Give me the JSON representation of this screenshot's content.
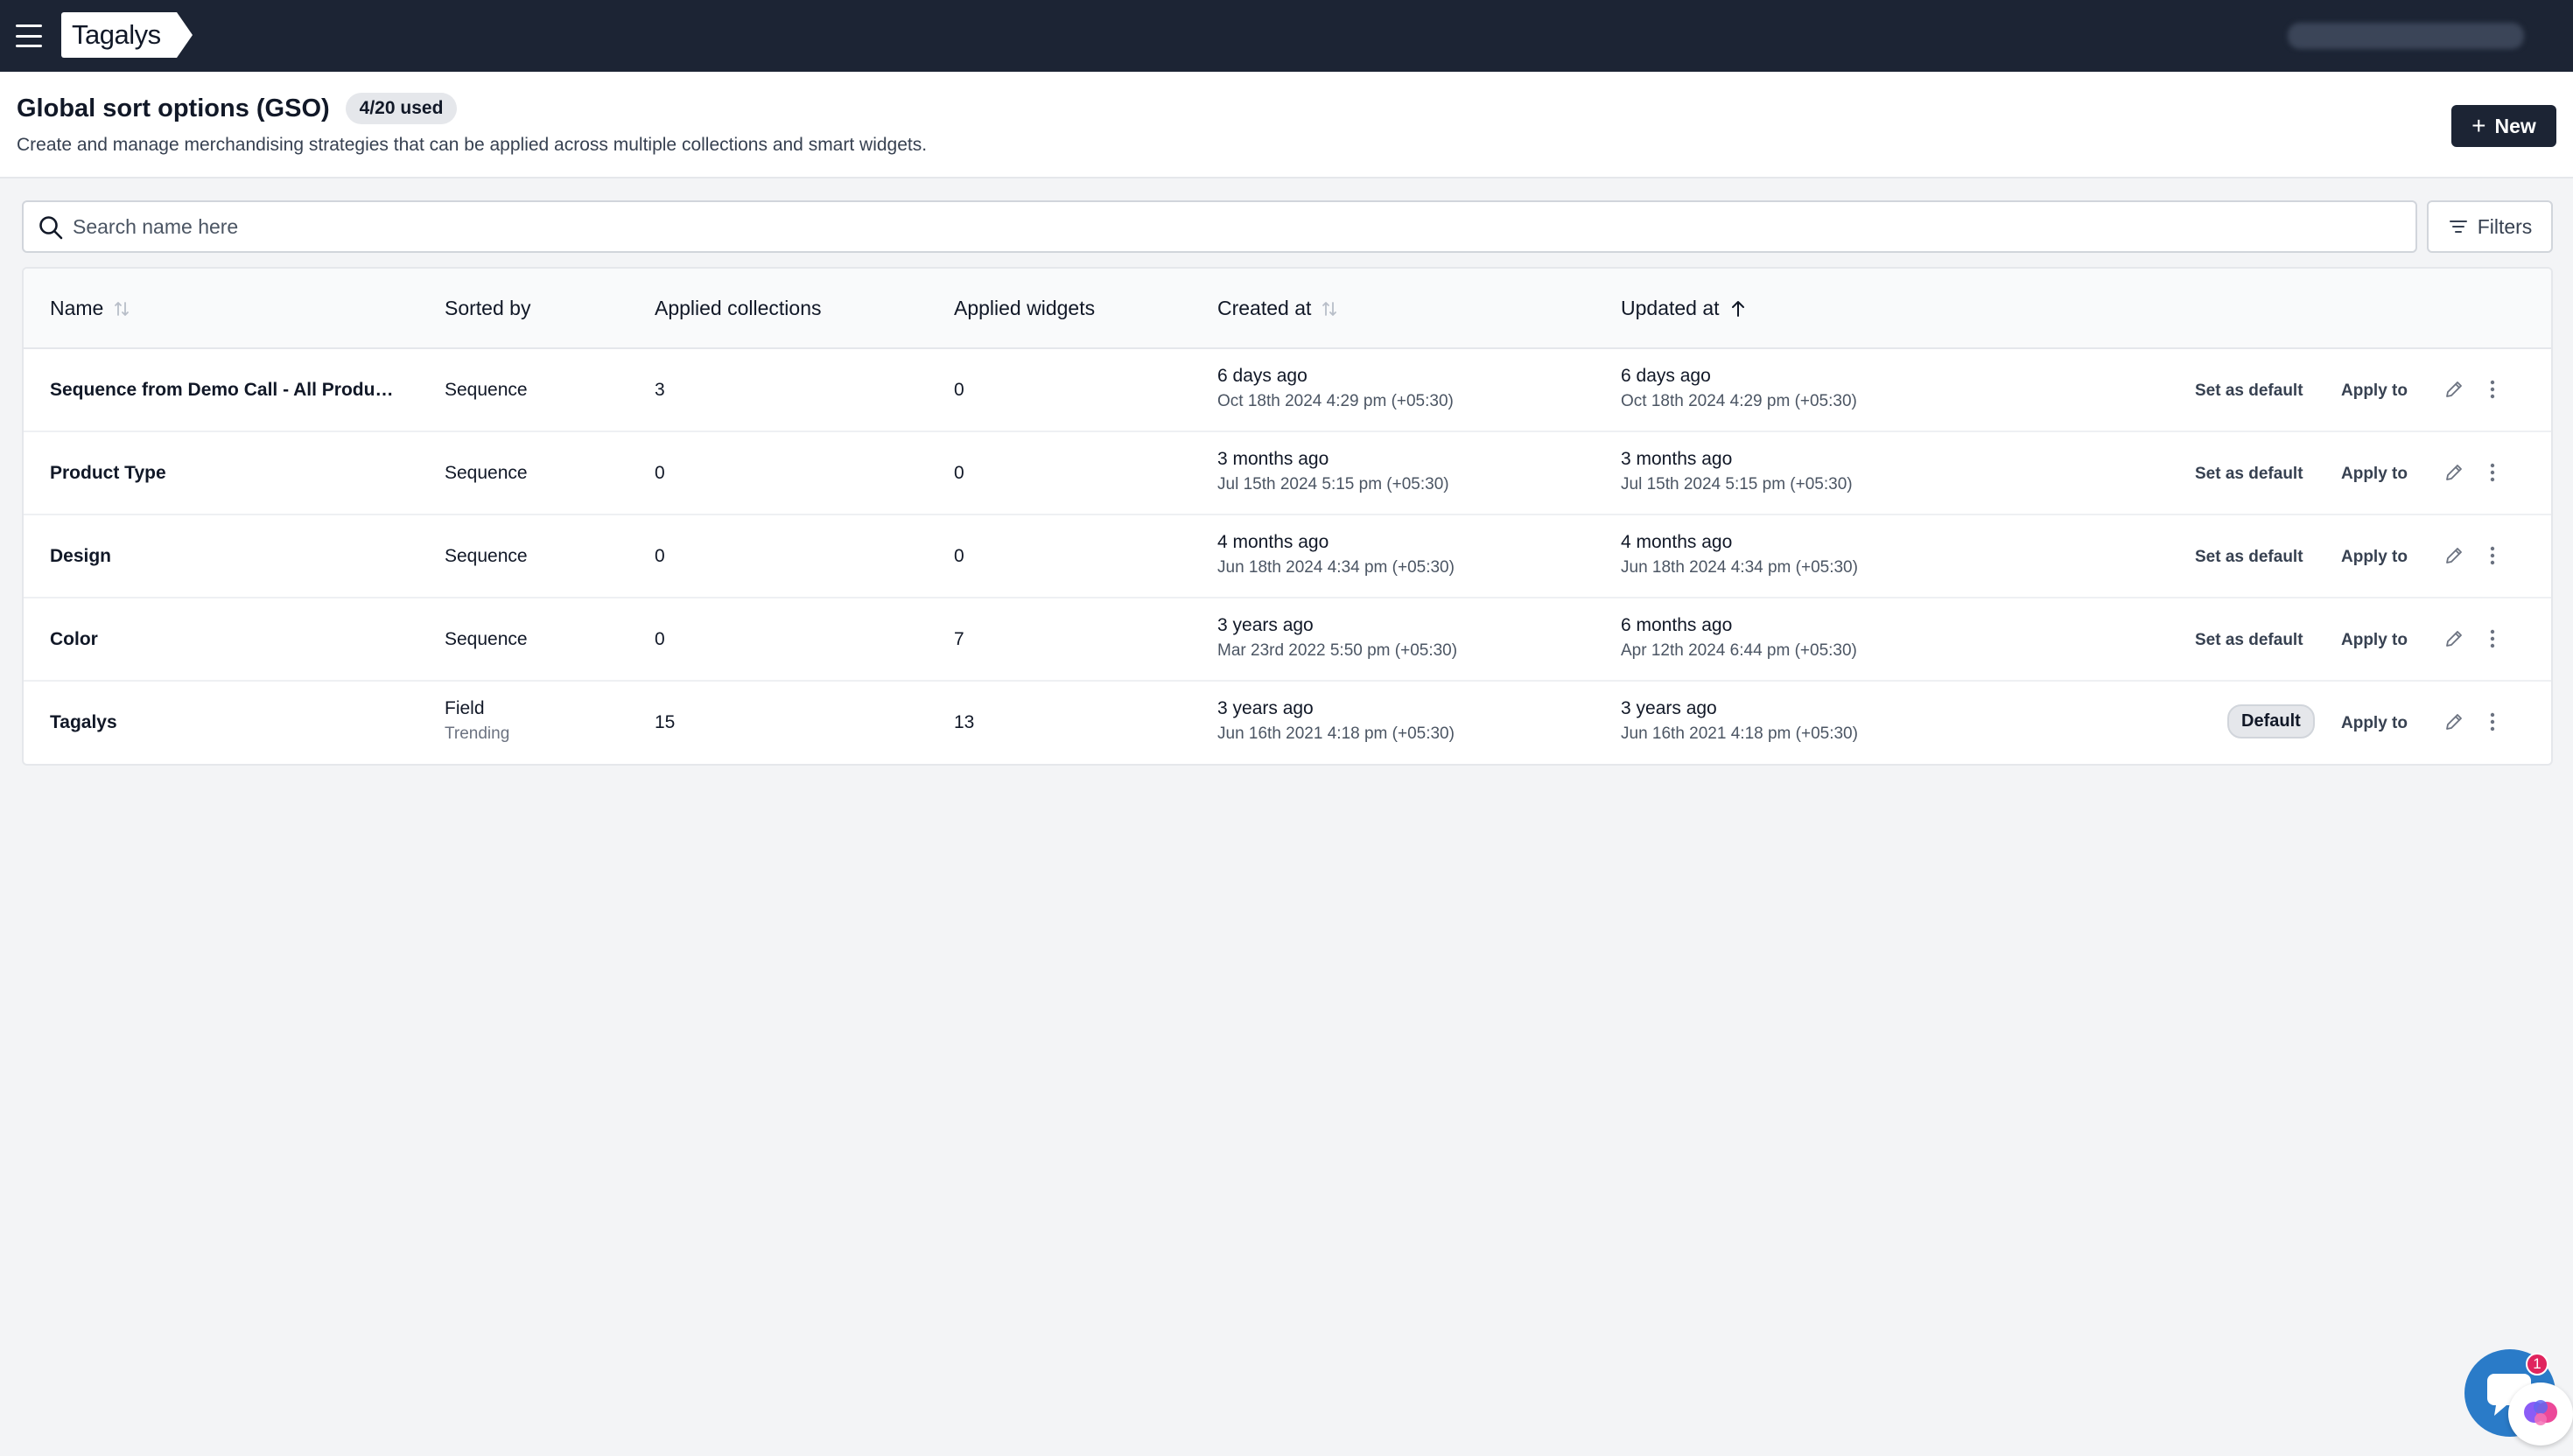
{
  "app": {
    "logo_text": "Tagalys"
  },
  "header": {
    "title": "Global sort options (GSO)",
    "used_badge": "4/20 used",
    "subtitle": "Create and manage merchandising strategies that can be applied across multiple collections and smart widgets.",
    "new_button": "New"
  },
  "search": {
    "placeholder": "Search name here",
    "value": ""
  },
  "filters_button": "Filters",
  "table": {
    "columns": {
      "name": "Name",
      "sorted_by": "Sorted by",
      "applied_collections": "Applied collections",
      "applied_widgets": "Applied widgets",
      "created_at": "Created at",
      "updated_at": "Updated at"
    },
    "rows": [
      {
        "name": "Sequence from Demo Call - All Produc...",
        "sorted_by": "Sequence",
        "sorted_by_sub": "",
        "collections": "3",
        "widgets": "0",
        "created_rel": "6 days ago",
        "created_abs": "Oct 18th 2024 4:29 pm (+05:30)",
        "updated_rel": "6 days ago",
        "updated_abs": "Oct 18th 2024 4:29 pm (+05:30)",
        "set_default": "Set as default",
        "apply_to": "Apply to"
      },
      {
        "name": "Product Type",
        "sorted_by": "Sequence",
        "sorted_by_sub": "",
        "collections": "0",
        "widgets": "0",
        "created_rel": "3 months ago",
        "created_abs": "Jul 15th 2024 5:15 pm (+05:30)",
        "updated_rel": "3 months ago",
        "updated_abs": "Jul 15th 2024 5:15 pm (+05:30)",
        "set_default": "Set as default",
        "apply_to": "Apply to"
      },
      {
        "name": "Design",
        "sorted_by": "Sequence",
        "sorted_by_sub": "",
        "collections": "0",
        "widgets": "0",
        "created_rel": "4 months ago",
        "created_abs": "Jun 18th 2024 4:34 pm (+05:30)",
        "updated_rel": "4 months ago",
        "updated_abs": "Jun 18th 2024 4:34 pm (+05:30)",
        "set_default": "Set as default",
        "apply_to": "Apply to"
      },
      {
        "name": "Color",
        "sorted_by": "Sequence",
        "sorted_by_sub": "",
        "collections": "0",
        "widgets": "7",
        "created_rel": "3 years ago",
        "created_abs": "Mar 23rd 2022 5:50 pm (+05:30)",
        "updated_rel": "6 months ago",
        "updated_abs": "Apr 12th 2024 6:44 pm (+05:30)",
        "set_default": "Set as default",
        "apply_to": "Apply to"
      },
      {
        "name": "Tagalys",
        "sorted_by": "Field",
        "sorted_by_sub": "Trending",
        "collections": "15",
        "widgets": "13",
        "created_rel": "3 years ago",
        "created_abs": "Jun 16th 2021 4:18 pm (+05:30)",
        "updated_rel": "3 years ago",
        "updated_abs": "Jun 16th 2021 4:18 pm (+05:30)",
        "default_badge": "Default",
        "apply_to": "Apply to"
      }
    ]
  },
  "chat": {
    "unread_count": "1"
  },
  "colors": {
    "nav_bg": "#1c2434",
    "primary": "#1c2434",
    "page_bg": "#f3f4f6",
    "chat": "#2a7bc8",
    "badge": "#e0245e"
  },
  "icons": [
    "menu-icon",
    "search-icon",
    "filter-icon",
    "sort-icon",
    "arrow-up-icon",
    "pencil-icon",
    "more-vertical-icon",
    "chat-icon",
    "brain-icon"
  ]
}
